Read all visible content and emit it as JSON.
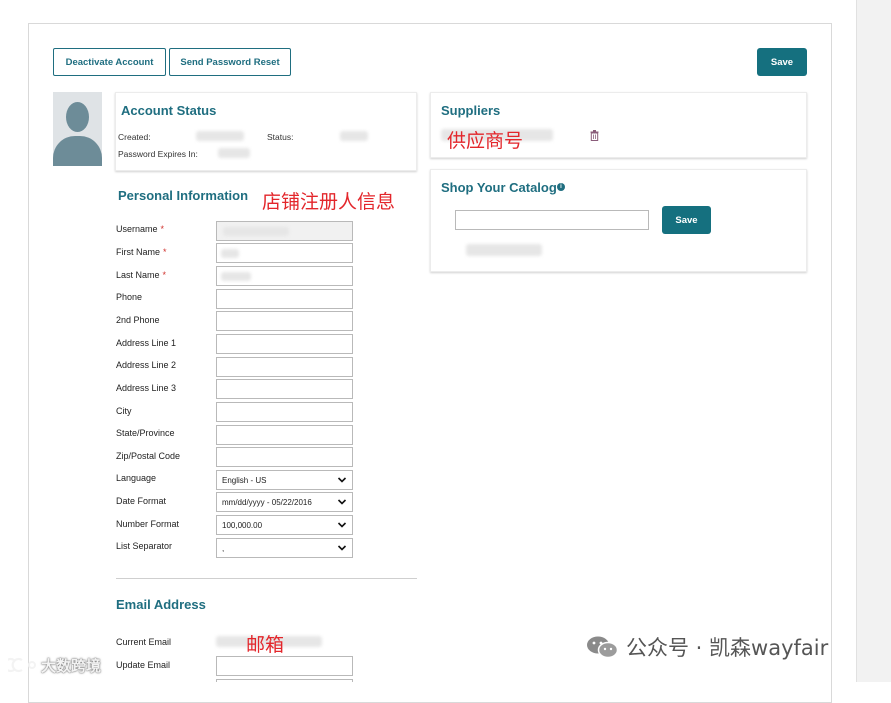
{
  "toolbar": {
    "deactivate_label": "Deactivate Account",
    "password_reset_label": "Send Password Reset",
    "save_label": "Save"
  },
  "account_status": {
    "title": "Account Status",
    "created_label": "Created:",
    "status_label": "Status:",
    "password_expires_label": "Password Expires In:"
  },
  "suppliers": {
    "title": "Suppliers",
    "annotation": "供应商号"
  },
  "catalog": {
    "title": "Shop Your Catalog",
    "save_label": "Save",
    "input_value": ""
  },
  "personal_info": {
    "title": "Personal Information",
    "annotation": "店铺注册人信息",
    "fields": [
      {
        "label": "Username",
        "required": "*"
      },
      {
        "label": "First Name",
        "required": "*"
      },
      {
        "label": "Last Name",
        "required": "*"
      },
      {
        "label": "Phone",
        "required": ""
      },
      {
        "label": "2nd Phone",
        "required": ""
      },
      {
        "label": "Address Line 1",
        "required": ""
      },
      {
        "label": "Address Line 2",
        "required": ""
      },
      {
        "label": "Address Line 3",
        "required": ""
      },
      {
        "label": "City",
        "required": ""
      },
      {
        "label": "State/Province",
        "required": ""
      },
      {
        "label": "Zip/Postal Code",
        "required": ""
      }
    ],
    "selects": [
      {
        "label": "Language",
        "value": "English - US"
      },
      {
        "label": "Date Format",
        "value": "mm/dd/yyyy - 05/22/2016"
      },
      {
        "label": "Number Format",
        "value": "100,000.00"
      },
      {
        "label": "List Separator",
        "value": ","
      }
    ]
  },
  "email": {
    "title": "Email Address",
    "annotation": "邮箱",
    "current_label": "Current Email",
    "update_label": "Update Email"
  },
  "watermarks": {
    "right": "公众号 · 凯森wayfair",
    "left": "大数跨境"
  },
  "colors": {
    "accent": "#1f6e80",
    "annotation": "#e3262b"
  }
}
